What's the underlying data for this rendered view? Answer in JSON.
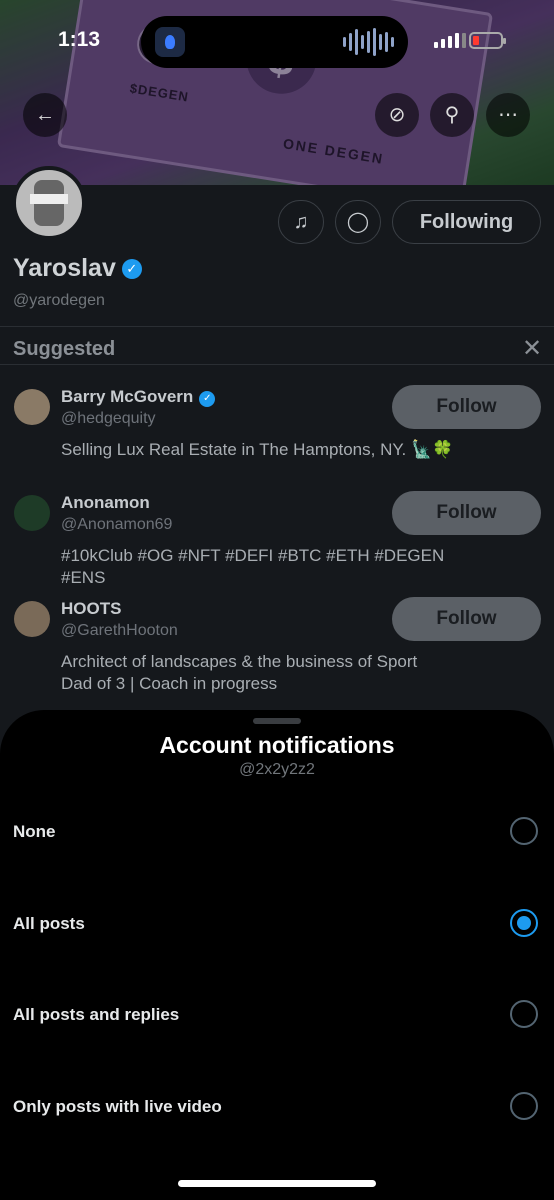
{
  "status_bar": {
    "time": "1:13"
  },
  "banner": {
    "bill_text_1": "$DEGEN",
    "bill_text_2": "ONE DEGEN",
    "dollar_symbol": "$"
  },
  "profile": {
    "name": "Yaroslav",
    "handle": "@yarodegen",
    "following_label": "Following"
  },
  "suggested": {
    "title": "Suggested",
    "items": [
      {
        "name": "Barry McGovern",
        "handle": "@hedgequity",
        "bio": "Selling Lux Real Estate in The Hamptons, NY. 🗽🍀",
        "follow_label": "Follow",
        "verified": true
      },
      {
        "name": "Anonamon",
        "handle": "@Anonamon69",
        "bio": "#10kClub #OG #NFT #DEFI #BTC #ETH #DEGEN #ENS",
        "follow_label": "Follow",
        "verified": false
      },
      {
        "name": "HOOTS",
        "handle": "@GarethHooton",
        "bio": "Architect of landscapes & the business of Sport\nDad of 3 | Coach in progress",
        "follow_label": "Follow",
        "verified": false
      }
    ]
  },
  "sheet": {
    "title": "Account notifications",
    "subtitle": "@2x2y2z2",
    "options": [
      {
        "label": "None",
        "selected": false
      },
      {
        "label": "All posts",
        "selected": true
      },
      {
        "label": "All posts and replies",
        "selected": false
      },
      {
        "label": "Only posts with live video",
        "selected": false
      }
    ]
  },
  "colors": {
    "accent": "#1d9bf0",
    "sheet_bg": "#000000",
    "page_bg": "#15181c"
  },
  "icons": [
    "back-arrow-icon",
    "hide-icon",
    "search-icon",
    "more-icon",
    "bell-icon",
    "message-icon",
    "verified-icon",
    "close-icon"
  ]
}
